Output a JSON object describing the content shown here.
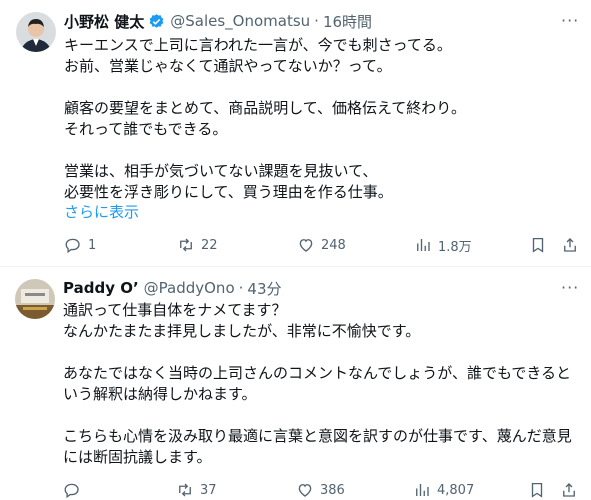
{
  "tweet1": {
    "name": "小野松 健太",
    "handle": "@Sales_Onomatsu",
    "separator": "·",
    "time": "16時間",
    "lines": [
      "キーエンスで上司に言われた一言が、今でも刺さってる。",
      "お前、営業じゃなくて通訳やってないか？って。",
      "",
      "顧客の要望をまとめて、商品説明して、価格伝えて終わり。",
      "それって誰でもできる。",
      "",
      "営業は、相手が気づいてない課題を見抜いて、",
      "必要性を浮き彫りにして、買う理由を作る仕事。"
    ],
    "show_more": "さらに表示",
    "replies": "1",
    "reposts": "22",
    "likes": "248",
    "views": "1.8万"
  },
  "tweet2": {
    "name": "Paddy O’",
    "handle": "@PaddyOno",
    "separator": "·",
    "time": "43分",
    "lines": [
      "通訳って仕事自体をナメてます？",
      "なんかたまたま拝見しましたが、非常に不愉快です。",
      "",
      "あなたではなく当時の上司さんのコメントなんでしょうが、誰でもできると",
      "いう解釈は納得しかねます。",
      "",
      "こちらも心情を汲み取り最適に言葉と意図を訳すのが仕事です、蔑んだ意見",
      "には断固抗議します。"
    ],
    "reposts": "37",
    "likes": "386",
    "views": "4,807"
  },
  "colors": {
    "text": "#0f1419",
    "secondary": "#536471",
    "link": "#1d9bf0",
    "verified": "#1d9bf0"
  }
}
